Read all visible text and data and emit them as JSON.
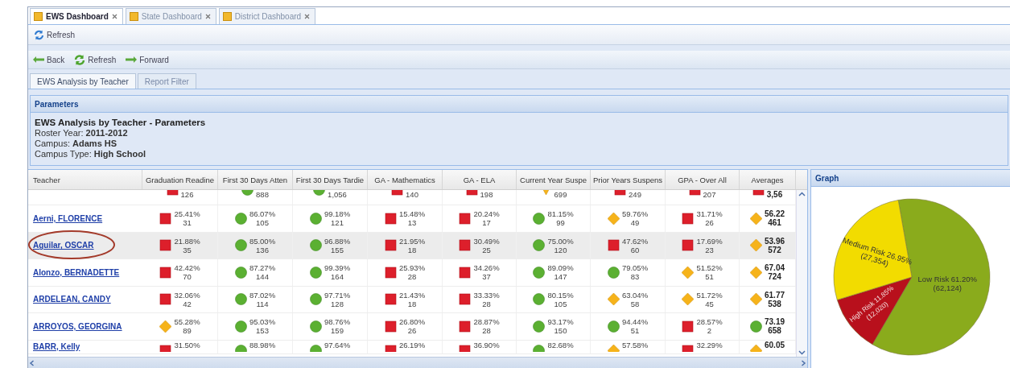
{
  "tabs": [
    {
      "label": "EWS Dashboard",
      "selected": true
    },
    {
      "label": "State Dashboard",
      "selected": false
    },
    {
      "label": "District Dashboard",
      "selected": false
    }
  ],
  "toolbar": {
    "refresh": "Refresh"
  },
  "nav": {
    "back": "Back",
    "refresh": "Refresh",
    "forward": "Forward"
  },
  "subtabs": [
    {
      "label": "EWS Analysis by Teacher",
      "selected": true
    },
    {
      "label": "Report Filter",
      "selected": false
    }
  ],
  "parameters": {
    "header": "Parameters",
    "title": "EWS Analysis by Teacher - Parameters",
    "lines": [
      "Roster Year: **2011-2012**",
      "Campus: **Adams HS**",
      "Campus Type: **High School**"
    ]
  },
  "table": {
    "columns": [
      "Teacher",
      "Graduation Readine",
      "First 30 Days Atten",
      "First 30 Days Tardie",
      "GA - Mathematics",
      "GA - ELA",
      "Current Year Suspe",
      "Prior Years Suspens",
      "GPA - Over All",
      "Averages"
    ],
    "rows": [
      {
        "selected": false,
        "circled": false,
        "cells": [
          {
            "kind": "blank"
          },
          {
            "kind": "square",
            "count": "126"
          },
          {
            "kind": "circle",
            "count": "888"
          },
          {
            "kind": "circle",
            "count": "1,056"
          },
          {
            "kind": "square",
            "count": "140"
          },
          {
            "kind": "square",
            "count": "198"
          },
          {
            "kind": "triangle",
            "count": "699"
          },
          {
            "kind": "square",
            "count": "249"
          },
          {
            "kind": "square",
            "count": "207"
          },
          {
            "kind": "square",
            "count": "3,56"
          }
        ]
      },
      {
        "selected": false,
        "circled": false,
        "cells": [
          {
            "kind": "teacher",
            "text": "Aerni, FLORENCE"
          },
          {
            "kind": "square",
            "pct": "25.41%",
            "count": "31"
          },
          {
            "kind": "circle",
            "pct": "86.07%",
            "count": "105"
          },
          {
            "kind": "circle",
            "pct": "99.18%",
            "count": "121"
          },
          {
            "kind": "square",
            "pct": "15.48%",
            "count": "13"
          },
          {
            "kind": "square",
            "pct": "20.24%",
            "count": "17"
          },
          {
            "kind": "circle",
            "pct": "81.15%",
            "count": "99"
          },
          {
            "kind": "diamond",
            "pct": "59.76%",
            "count": "49"
          },
          {
            "kind": "square",
            "pct": "31.71%",
            "count": "26"
          },
          {
            "kind": "diamond",
            "pct": "56.22",
            "count": "461"
          }
        ]
      },
      {
        "selected": true,
        "circled": true,
        "cells": [
          {
            "kind": "teacher",
            "text": "Aguilar, OSCAR"
          },
          {
            "kind": "square",
            "pct": "21.88%",
            "count": "35"
          },
          {
            "kind": "circle",
            "pct": "85.00%",
            "count": "136"
          },
          {
            "kind": "circle",
            "pct": "96.88%",
            "count": "155"
          },
          {
            "kind": "square",
            "pct": "21.95%",
            "count": "18"
          },
          {
            "kind": "square",
            "pct": "30.49%",
            "count": "25"
          },
          {
            "kind": "circle",
            "pct": "75.00%",
            "count": "120"
          },
          {
            "kind": "square",
            "pct": "47.62%",
            "count": "60"
          },
          {
            "kind": "square",
            "pct": "17.69%",
            "count": "23"
          },
          {
            "kind": "diamond",
            "pct": "53.96",
            "count": "572"
          }
        ]
      },
      {
        "selected": false,
        "circled": false,
        "cells": [
          {
            "kind": "teacher",
            "text": "Alonzo, BERNADETTE"
          },
          {
            "kind": "square",
            "pct": "42.42%",
            "count": "70"
          },
          {
            "kind": "circle",
            "pct": "87.27%",
            "count": "144"
          },
          {
            "kind": "circle",
            "pct": "99.39%",
            "count": "164"
          },
          {
            "kind": "square",
            "pct": "25.93%",
            "count": "28"
          },
          {
            "kind": "square",
            "pct": "34.26%",
            "count": "37"
          },
          {
            "kind": "circle",
            "pct": "89.09%",
            "count": "147"
          },
          {
            "kind": "circle",
            "pct": "79.05%",
            "count": "83"
          },
          {
            "kind": "diamond",
            "pct": "51.52%",
            "count": "51"
          },
          {
            "kind": "diamond",
            "pct": "67.04",
            "count": "724"
          }
        ]
      },
      {
        "selected": false,
        "circled": false,
        "cells": [
          {
            "kind": "teacher",
            "text": "ARDELEAN, CANDY"
          },
          {
            "kind": "square",
            "pct": "32.06%",
            "count": "42"
          },
          {
            "kind": "circle",
            "pct": "87.02%",
            "count": "114"
          },
          {
            "kind": "circle",
            "pct": "97.71%",
            "count": "128"
          },
          {
            "kind": "square",
            "pct": "21.43%",
            "count": "18"
          },
          {
            "kind": "square",
            "pct": "33.33%",
            "count": "28"
          },
          {
            "kind": "circle",
            "pct": "80.15%",
            "count": "105"
          },
          {
            "kind": "diamond",
            "pct": "63.04%",
            "count": "58"
          },
          {
            "kind": "diamond",
            "pct": "51.72%",
            "count": "45"
          },
          {
            "kind": "diamond",
            "pct": "61.77",
            "count": "538"
          }
        ]
      },
      {
        "selected": false,
        "circled": false,
        "cells": [
          {
            "kind": "teacher",
            "text": "ARROYOS, GEORGINA"
          },
          {
            "kind": "diamond",
            "pct": "55.28%",
            "count": "89"
          },
          {
            "kind": "circle",
            "pct": "95.03%",
            "count": "153"
          },
          {
            "kind": "circle",
            "pct": "98.76%",
            "count": "159"
          },
          {
            "kind": "square",
            "pct": "26.80%",
            "count": "26"
          },
          {
            "kind": "square",
            "pct": "28.87%",
            "count": "28"
          },
          {
            "kind": "circle",
            "pct": "93.17%",
            "count": "150"
          },
          {
            "kind": "circle",
            "pct": "94.44%",
            "count": "51"
          },
          {
            "kind": "square",
            "pct": "28.57%",
            "count": "2"
          },
          {
            "kind": "circle",
            "pct": "73.19",
            "count": "658"
          }
        ]
      },
      {
        "selected": false,
        "circled": false,
        "cells": [
          {
            "kind": "teacher",
            "text": "BARR, Kelly"
          },
          {
            "kind": "square",
            "pct": "31.50%"
          },
          {
            "kind": "circle",
            "pct": "88.98%"
          },
          {
            "kind": "circle",
            "pct": "97.64%"
          },
          {
            "kind": "square",
            "pct": "26.19%"
          },
          {
            "kind": "square",
            "pct": "36.90%"
          },
          {
            "kind": "circle",
            "pct": "82.68%"
          },
          {
            "kind": "diamond",
            "pct": "57.58%"
          },
          {
            "kind": "square",
            "pct": "32.29%"
          },
          {
            "kind": "diamond",
            "pct": "60.05"
          }
        ]
      }
    ]
  },
  "graph": {
    "header": "Graph",
    "slices": [
      {
        "count": "(62,124)",
        "color": "#8aab1c"
      },
      {
        "count": "(12,020)",
        "color": "#b8101c"
      },
      {
        "count": "(27,354)",
        "color": "#f2dc00"
      }
    ],
    "chart_data": {
      "type": "pie",
      "categories": [
        "Low Risk",
        "High Risk",
        "Medium Risk"
      ],
      "values": [
        61.2,
        11.85,
        26.95
      ],
      "value_labels": [
        "61.20%",
        "11.85%",
        "26.95%"
      ]
    }
  }
}
